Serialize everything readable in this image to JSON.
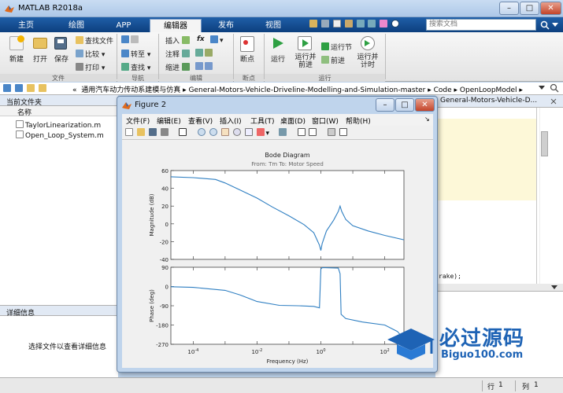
{
  "window": {
    "title": "MATLAB R2018a"
  },
  "tabs": [
    {
      "label": "主页"
    },
    {
      "label": "绘图"
    },
    {
      "label": "APP"
    },
    {
      "label": "编辑器"
    },
    {
      "label": "发布"
    },
    {
      "label": "视图"
    }
  ],
  "search": {
    "placeholder": "搜索文档"
  },
  "ribbon": {
    "file": {
      "new": "新建",
      "open": "打开",
      "save": "保存",
      "find_files": "查找文件",
      "compare": "比较",
      "print": "打印",
      "group": "文件"
    },
    "navigate": {
      "goto": "转至",
      "find": "查找",
      "group": "导航"
    },
    "edit": {
      "insert": "插入",
      "comment": "注释",
      "indent": "缩进",
      "fx": "fx",
      "group": "编辑"
    },
    "breakpoints": {
      "label": "断点",
      "group": "断点"
    },
    "run": {
      "run": "运行",
      "run_advance": "运行并\n前进",
      "run_section": "运行节",
      "advance": "前进",
      "run_time": "运行并\n计时",
      "group": "运行"
    }
  },
  "address": {
    "path": [
      "«",
      "通用汽车动力传动系建模与仿真",
      "General-Motors-Vehicle-Driveline-Modelling-and-Simulation-master",
      "Code",
      "OpenLoopModel"
    ]
  },
  "current_folder": {
    "title": "当前文件夹",
    "column": "名称",
    "files": [
      "TaylorLinearization.m",
      "Open_Loop_System.m"
    ]
  },
  "details": {
    "title": "详细信息",
    "message": "选择文件以查看详细信息"
  },
  "editor": {
    "tab_partial": "General-Motors-Vehicle-D...",
    "code_fragment": "rake);"
  },
  "status": {
    "row_label": "行",
    "row": "1",
    "col_label": "列",
    "col": "1"
  },
  "figure": {
    "title": "Figure 2",
    "menu": [
      "文件(F)",
      "编辑(E)",
      "查看(V)",
      "插入(I)",
      "工具(T)",
      "桌面(D)",
      "窗口(W)",
      "帮助(H)"
    ]
  },
  "watermark": {
    "cn": "必过源码",
    "en": "Biguo100.com"
  },
  "chart_data": {
    "type": "line",
    "title": "Bode Diagram",
    "subtitle": "From: Tm  To: Motor Speed",
    "xlabel": "Frequency  (Hz)",
    "x_scale": "log",
    "xlim": [
      2e-05,
      400
    ],
    "x_tick_labels": [
      "10^-4",
      "10^-2",
      "10^0",
      "10^2"
    ],
    "panels": [
      {
        "ylabel": "Magnitude (dB)",
        "ylim": [
          -40,
          60
        ],
        "yticks": [
          -40,
          -20,
          0,
          20,
          40,
          60
        ],
        "series": [
          {
            "x": [
              2e-05,
              0.0001,
              0.0005,
              0.001,
              0.003,
              0.01,
              0.03,
              0.1,
              0.3,
              0.6,
              0.9,
              1.0,
              1.1,
              1.5,
              2.5,
              3.5,
              4.0,
              4.5,
              6,
              10,
              30,
              100,
              400
            ],
            "y": [
              53,
              52,
              50,
              46,
              38,
              29,
              19,
              9,
              -1,
              -10,
              -24,
              -30,
              -22,
              -8,
              4,
              14,
              20,
              14,
              5,
              -2,
              -8,
              -13,
              -18
            ]
          }
        ]
      },
      {
        "ylabel": "Phase (deg)",
        "ylim": [
          -270,
          90
        ],
        "yticks": [
          -270,
          -180,
          -90,
          0,
          90
        ],
        "series": [
          {
            "x": [
              2e-05,
              0.0001,
              0.001,
              0.003,
              0.01,
              0.05,
              0.2,
              0.6,
              0.9,
              1.0,
              1.1,
              3.5,
              4.0,
              4.3,
              6,
              20,
              100,
              250,
              400
            ],
            "y": [
              -1,
              -4,
              -18,
              -40,
              -70,
              -88,
              -90,
              -93,
              -100,
              82,
              88,
              86,
              60,
              -130,
              -150,
              -166,
              -180,
              -210,
              -245
            ]
          }
        ]
      }
    ]
  }
}
